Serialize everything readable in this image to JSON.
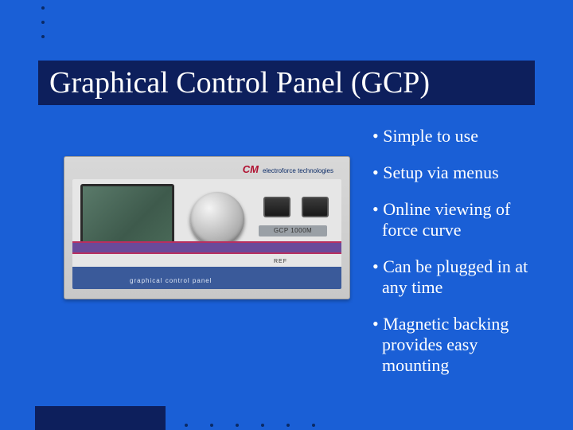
{
  "title": "Graphical Control Panel (GCP)",
  "bullets": [
    "Simple to use",
    "Setup via menus",
    "Online viewing of force curve",
    "Can be plugged in at any time",
    "Magnetic backing provides easy mounting"
  ],
  "device": {
    "brand": "CM",
    "brand_sub": "electroforce technologies",
    "model": "GCP 1000M",
    "footer": "graphical control panel",
    "ref": "REF"
  }
}
